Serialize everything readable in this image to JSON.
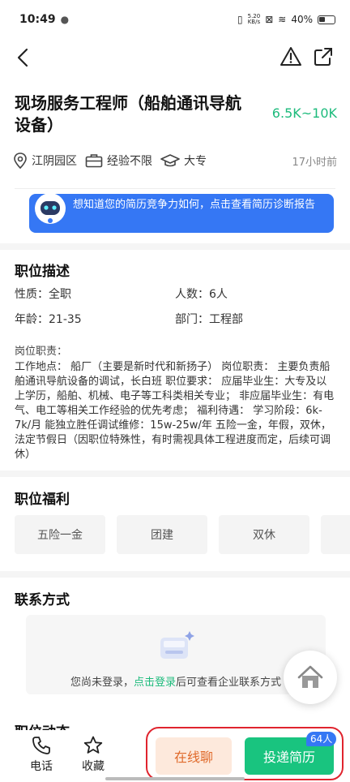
{
  "status": {
    "time": "10:49",
    "speed_value": "5.20",
    "speed_unit": "KB/s",
    "battery": "40%"
  },
  "job": {
    "title": "现场服务工程师（船舶通讯导航设备）",
    "salary": "6.5K~10K",
    "location": "江阴园区",
    "experience": "经验不限",
    "education": "大专",
    "posted": "17小时前"
  },
  "banner": {
    "text": "想知道您的简历竞争力如何，点击查看简历诊断报告"
  },
  "description": {
    "title": "职位描述",
    "nature_label": "性质：",
    "nature_value": "全职",
    "headcount_label": "人数：",
    "headcount_value": "6人",
    "age_label": "年龄：",
    "age_value": "21-35",
    "dept_label": "部门：",
    "dept_value": "工程部",
    "duty_label": "岗位职责：",
    "duty_text": "工作地点：  船厂（主要是新时代和新扬子）  岗位职责：  主要负责船舶通讯导航设备的调试，长白班  职位要求：  应届毕业生：大专及以上学历，船舶、机械、电子等工科类相关专业；  非应届毕业生：有电气、电工等相关工作经验的优先考虑；  福利待遇：  学习阶段：6k-7k/月  能独立胜任调试维修：15w-25w/年  五险一金，年假，双休，法定节假日（因职位特殊性，有时需视具体工程进度而定，后续可调休）"
  },
  "benefits": {
    "title": "职位福利",
    "items": [
      "五险一金",
      "团建",
      "双休",
      ""
    ]
  },
  "contact": {
    "title": "联系方式",
    "hint_prefix": "您尚未登录，",
    "hint_link": "点击登录",
    "hint_suffix": "后可查看企业联系方式"
  },
  "dynamics": {
    "title": "职位动态"
  },
  "bottom": {
    "phone_label": "电话",
    "favorite_label": "收藏",
    "chat_label": "在线聊",
    "apply_label": "投递简历",
    "apply_count": "64人"
  },
  "colors": {
    "accent_green": "#19c47f",
    "salary_green": "#1dbb7c",
    "banner_blue": "#3577f4",
    "highlight_red": "#e0242e"
  }
}
